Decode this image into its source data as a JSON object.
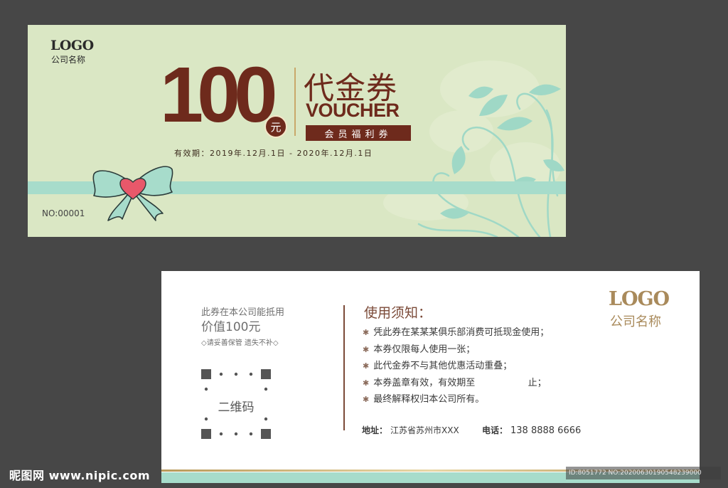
{
  "front": {
    "logo_text": "LOGO",
    "company_name": "公司名称",
    "amount": "100",
    "yuan": "元",
    "title_cn": "代金券",
    "title_en": "VOUCHER",
    "member_badge": "会员福利券",
    "validity": "有效期：2019年.12月.1日 - 2020年.12月.1日",
    "serial": "NO:00001",
    "colors": {
      "background": "#dae7c4",
      "brand_brown": "#6e2a1c",
      "ribbon": "#a7dccb",
      "heart": "#e8586a"
    }
  },
  "back": {
    "worth_line1": "此券在本公司能抵用",
    "worth_line2": "价值100元",
    "keep_note": "◇请妥善保管 遗失不补◇",
    "qr_label": "二维码",
    "notice_title": "使用须知：",
    "rules": [
      "凭此券在某某某俱乐部消费可抵现金使用；",
      "本券仅限每人使用一张；",
      "此代金券不与其他优惠活动重叠；",
      "本券盖章有效，有效期至                  止；",
      "最终解释权归本公司所有。"
    ],
    "address_label": "地址：",
    "address_value": "江苏省苏州市XXX",
    "phone_label": "电话：",
    "phone_value": "138 8888 6666",
    "logo_text": "LOGO",
    "company_name": "公司名称",
    "colors": {
      "gold": "#a98a5b",
      "brown": "#7b4a38",
      "band": "#a7dccb"
    }
  },
  "watermark": {
    "left": "昵图网 www.nipic.com",
    "right": "ID:8051772 NO:20200630190548239000"
  }
}
